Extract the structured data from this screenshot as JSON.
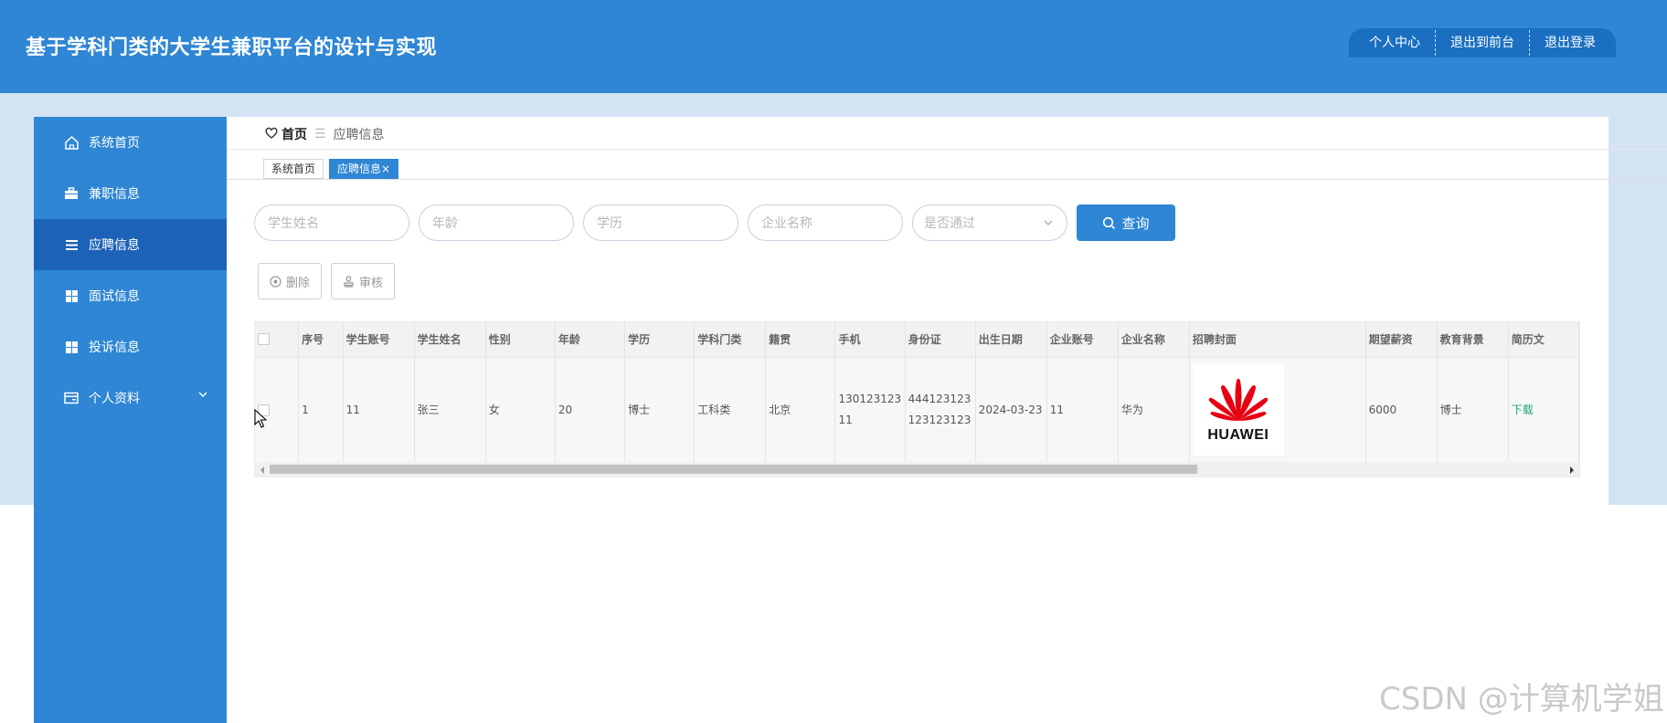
{
  "header": {
    "title": "基于学科门类的大学生兼职平台的设计与实现",
    "nav": [
      "个人中心",
      "退出到前台",
      "退出登录"
    ]
  },
  "sidebar": {
    "items": [
      {
        "label": "系统首页",
        "icon": "home-icon"
      },
      {
        "label": "兼职信息",
        "icon": "briefcase-icon"
      },
      {
        "label": "应聘信息",
        "icon": "list-icon",
        "active": true
      },
      {
        "label": "面试信息",
        "icon": "grid-icon"
      },
      {
        "label": "投诉信息",
        "icon": "grid-icon"
      },
      {
        "label": "个人资料",
        "icon": "card-icon",
        "has_submenu": true
      }
    ]
  },
  "breadcrumb": {
    "home": "首页",
    "separator": "☰",
    "current": "应聘信息"
  },
  "tabs": [
    {
      "label": "系统首页",
      "active": false
    },
    {
      "label": "应聘信息",
      "active": true,
      "close": "×"
    }
  ],
  "filters": {
    "student_name_placeholder": "学生姓名",
    "age_placeholder": "年龄",
    "education_placeholder": "学历",
    "company_placeholder": "企业名称",
    "passed_placeholder": "是否通过",
    "query_label": "查询"
  },
  "actions": {
    "delete_label": "删除",
    "review_label": "审核"
  },
  "table": {
    "columns": [
      "序号",
      "学生账号",
      "学生姓名",
      "性别",
      "年龄",
      "学历",
      "学科门类",
      "籍贯",
      "手机",
      "身份证",
      "出生日期",
      "企业账号",
      "企业名称",
      "招聘封面",
      "期望薪资",
      "教育背景",
      "简历文"
    ],
    "rows": [
      {
        "index": "1",
        "student_account": "11",
        "student_name": "张三",
        "gender": "女",
        "age": "20",
        "education": "博士",
        "discipline": "工科类",
        "hometown": "北京",
        "phone": "13012312311",
        "id_card": "444123123123123123",
        "birth_date": "2024-03-23",
        "company_account": "11",
        "company_name": "华为",
        "cover_logo_text": "HUAWEI",
        "salary": "6000",
        "edu_background": "博士",
        "resume": "下载"
      }
    ]
  },
  "colors": {
    "header_bg": "#2e86d4",
    "sidebar_bg": "#2e86d4",
    "sidebar_active": "#1c63b7",
    "page_bg": "#d3e3f4",
    "download_link": "#1fa67a",
    "huawei_red": "#e60012"
  },
  "watermark": "CSDN @计算机学姐"
}
